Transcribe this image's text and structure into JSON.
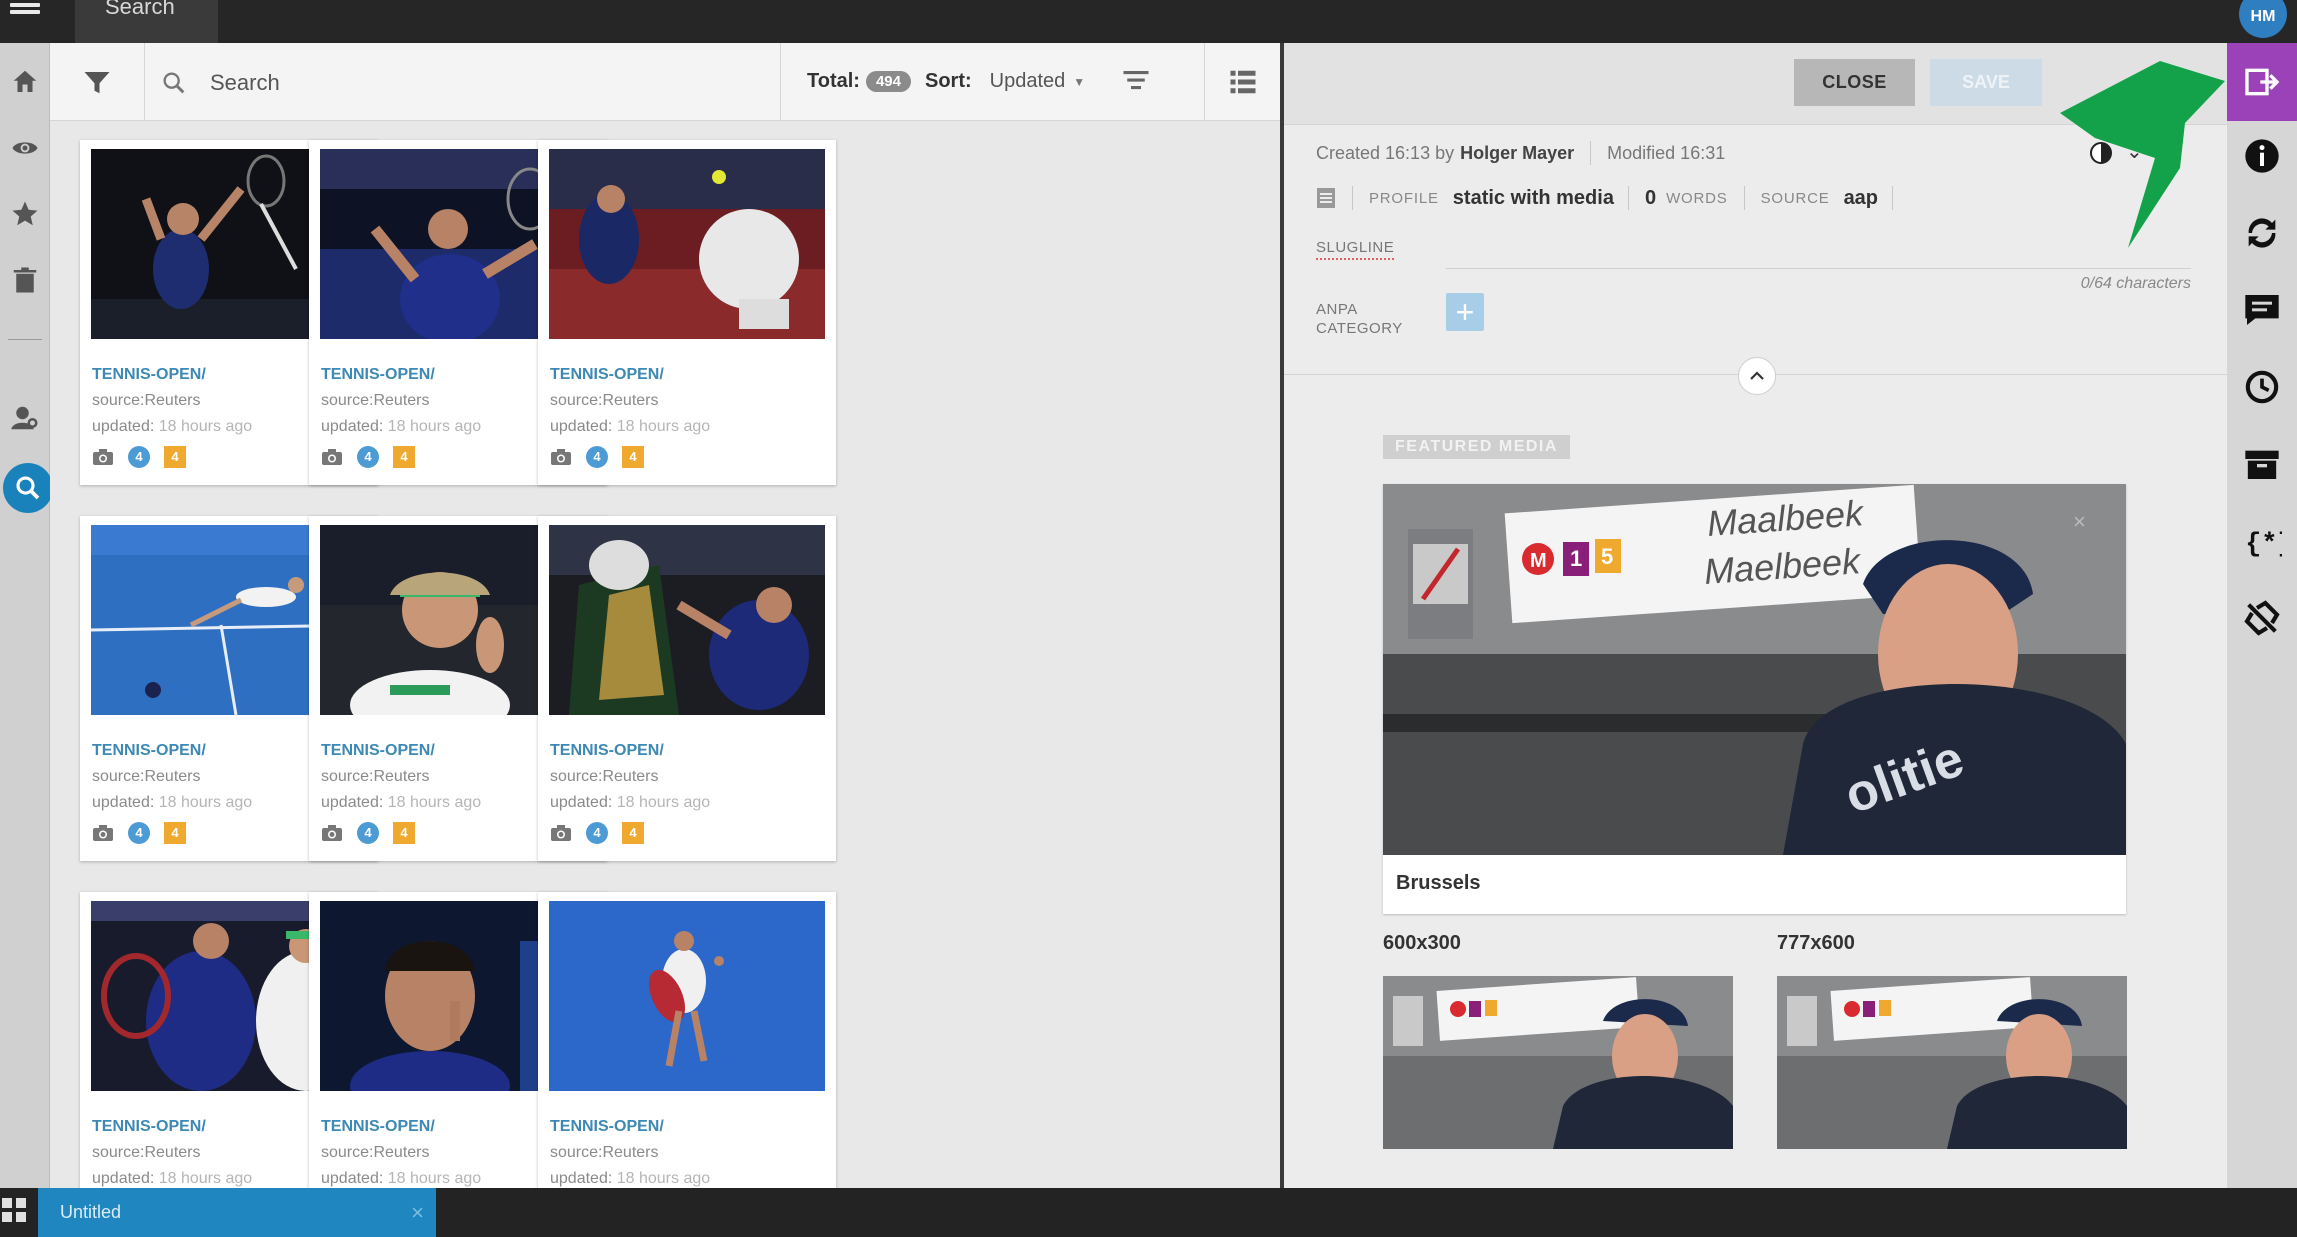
{
  "topbar": {
    "search_label": "Search",
    "avatar_initials": "HM"
  },
  "toolbar": {
    "search_placeholder": "Search",
    "total_label": "Total:",
    "total_count": "494",
    "sort_label": "Sort:",
    "sort_value": "Updated"
  },
  "cards": [
    {
      "slug": "TENNIS-OPEN/",
      "source": "source:Reuters",
      "updated_label": "updated:",
      "updated_ago": "18 hours ago",
      "badge_blue": "4",
      "badge_orange": "4"
    },
    {
      "slug": "TENNIS-OPEN/",
      "source": "source:Reuters",
      "updated_label": "updated:",
      "updated_ago": "18 hours ago",
      "badge_blue": "4",
      "badge_orange": "4"
    },
    {
      "slug": "TENNIS-OPEN/",
      "source": "source:Reuters",
      "updated_label": "updated:",
      "updated_ago": "18 hours ago",
      "badge_blue": "4",
      "badge_orange": "4"
    },
    {
      "slug": "TENNIS-OPEN/",
      "source": "source:Reuters",
      "updated_label": "updated:",
      "updated_ago": "18 hours ago",
      "badge_blue": "4",
      "badge_orange": "4"
    },
    {
      "slug": "TENNIS-OPEN/",
      "source": "source:Reuters",
      "updated_label": "updated:",
      "updated_ago": "18 hours ago",
      "badge_blue": "4",
      "badge_orange": "4"
    },
    {
      "slug": "TENNIS-OPEN/",
      "source": "source:Reuters",
      "updated_label": "updated:",
      "updated_ago": "18 hours ago",
      "badge_blue": "4",
      "badge_orange": "4"
    },
    {
      "slug": "TENNIS-OPEN/",
      "source": "source:Reuters",
      "updated_label": "updated:",
      "updated_ago": "18 hours ago"
    },
    {
      "slug": "TENNIS-OPEN/",
      "source": "source:Reuters",
      "updated_label": "updated:",
      "updated_ago": "18 hours ago"
    },
    {
      "slug": "TENNIS-OPEN/",
      "source": "source:Reuters",
      "updated_label": "updated:",
      "updated_ago": "18 hours ago"
    }
  ],
  "editor": {
    "close_label": "CLOSE",
    "save_label": "SAVE",
    "created_text": "Created 16:13 by",
    "created_by": "Holger Mayer",
    "modified_text": "Modified 16:31",
    "profile_label": "PROFILE",
    "profile_value": "static with media",
    "words_count": "0",
    "words_label": "WORDS",
    "source_label": "SOURCE",
    "source_value": "aap",
    "slugline_label": "SLUGLINE",
    "char_count": "0/64 characters",
    "anpa_label_1": "ANPA",
    "anpa_label_2": "CATEGORY",
    "featured_label": "FEATURED MEDIA",
    "featured_caption": "Brussels",
    "crop1_label": "600x300",
    "crop2_label": "777x600",
    "station_line1": "Maalbeek",
    "station_line2": "Maelbeek",
    "sign_m": "M",
    "sign_1": "1",
    "sign_5": "5",
    "police_text": "olitie"
  },
  "bottombar": {
    "tab_label": "Untitled"
  },
  "colors": {
    "accent_blue": "#1f86c0",
    "rightbar_active": "#9c42b8",
    "arrow_green": "#13a24a",
    "slug_blue": "#3d89b5"
  }
}
